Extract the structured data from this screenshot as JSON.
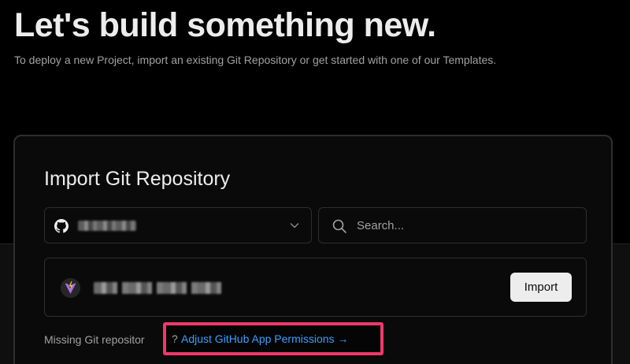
{
  "header": {
    "title": "Let's build something new.",
    "subtitle": "To deploy a new Project, import an existing Git Repository or get started with one of our Templates."
  },
  "import_card": {
    "title": "Import Git Repository",
    "account_select": {
      "selected_value": "████████",
      "icon": "github-icon"
    },
    "search": {
      "placeholder": "Search...",
      "value": ""
    },
    "repositories": [
      {
        "name": "████████ ██████",
        "icon": "vite-icon",
        "action_label": "Import"
      }
    ],
    "missing_repo": {
      "label": "Missing Git repositor",
      "question_mark": "?",
      "link_text": "Adjust GitHub App Permissions →"
    }
  },
  "colors": {
    "background": "#000000",
    "card_background": "#0a0a0a",
    "border": "#2e2e2e",
    "link": "#3b9eff",
    "highlight": "#f0386b",
    "button_background": "#ededed"
  }
}
